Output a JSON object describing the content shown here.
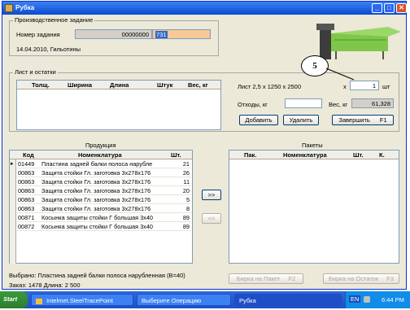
{
  "window": {
    "title": "Рубка",
    "buttons": [
      "_",
      "□",
      "✕"
    ]
  },
  "production_task": {
    "group_label": "Производственное задание",
    "task_number_label": "Номер задания",
    "task_number_prefix": "00000000",
    "task_number_value": "731",
    "date_line": "14.04.2010, Гильотины"
  },
  "annotation": {
    "number": "5"
  },
  "sheet": {
    "group_label": "Лист и остатки",
    "columns": [
      "Толщ.",
      "Ширина",
      "Длина",
      "Штук",
      "Вес, кг"
    ],
    "sheet_desc": "Лист 2,5 x 1250 x 2500",
    "x_label": "x",
    "qty": "1",
    "qty_unit": "шт",
    "waste_label": "Отходы, кг",
    "waste_value": "",
    "weight_label": "Вес, кг",
    "weight_value": "61,328",
    "add_label": "Добавить",
    "delete_label": "Удалить",
    "finish_label": "Завершить",
    "finish_key": "F1"
  },
  "products": {
    "title": "Продукция",
    "columns": [
      "Код",
      "Номенклатура",
      "Шт."
    ],
    "rows": [
      {
        "code": "01449",
        "name": "Пластина задней балки полоса нарубле",
        "qty": "21"
      },
      {
        "code": "00863",
        "name": "Защита стойки Гл. заготовка 3x278x176",
        "qty": "26"
      },
      {
        "code": "00863",
        "name": "Защита стойки Гл. заготовка 3x278x176",
        "qty": "11"
      },
      {
        "code": "00863",
        "name": "Защита стойки Гл. заготовка 3x278x176",
        "qty": "20"
      },
      {
        "code": "00863",
        "name": "Защита стойки Гл. заготовка 3x278x176",
        "qty": "5"
      },
      {
        "code": "00863",
        "name": "Защита стойки Гл. заготовка 3x278x176",
        "qty": "8"
      },
      {
        "code": "00871",
        "name": "Косынка защиты стойки Г большая 3x40",
        "qty": "89"
      },
      {
        "code": "00872",
        "name": "Косынка защиты стойки Г большая 3x40",
        "qty": "89"
      }
    ]
  },
  "transfer": {
    "to_right": ">>",
    "to_left": "<<"
  },
  "packages": {
    "title": "Пакеты",
    "columns": [
      "Пак.",
      "Номенклатура",
      "Шт.",
      "К."
    ],
    "tag_package_label": "Бирка на Пакет",
    "tag_package_key": "F2",
    "tag_remainder_label": "Бирка на Остаток",
    "tag_remainder_key": "F3"
  },
  "status": {
    "selected": "Выбрано: Пластина задней балки полоса нарубленная (В=40)",
    "order": "Заказ: 1478  Длина: 2 500"
  },
  "taskbar": {
    "start": "Start",
    "items": [
      "Intelmet.SteelTracePoint",
      "Выберите Операцию",
      "Рубка"
    ],
    "tray_lang": "EN",
    "time": "6:44 PM"
  }
}
